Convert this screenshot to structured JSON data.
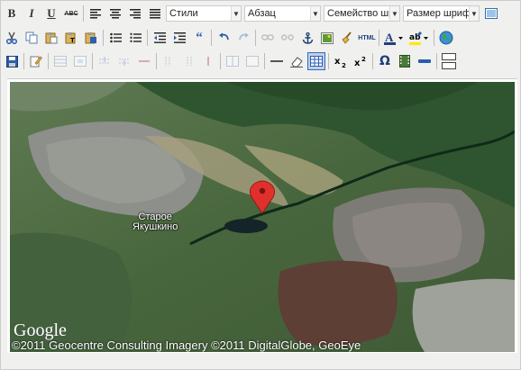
{
  "toolbar": {
    "styles_select": "Стили",
    "format_select": "Абзац",
    "font_family_select": "Семейство шр",
    "font_size_select": "Размер шрифт",
    "html_button_label": "HTML",
    "strikethrough_label": "ABC"
  },
  "map": {
    "place_label_line1": "Старое",
    "place_label_line2": "Якушкино",
    "logo_text": "Google",
    "copyright": "©2011 Geocentre Consulting  Imagery ©2011 DigitalGlobe, GeoEye"
  },
  "colors": {
    "toolbar_bg": "#f0f0ee",
    "active_button": "#c2cfe5",
    "marker_red": "#e0302c"
  }
}
